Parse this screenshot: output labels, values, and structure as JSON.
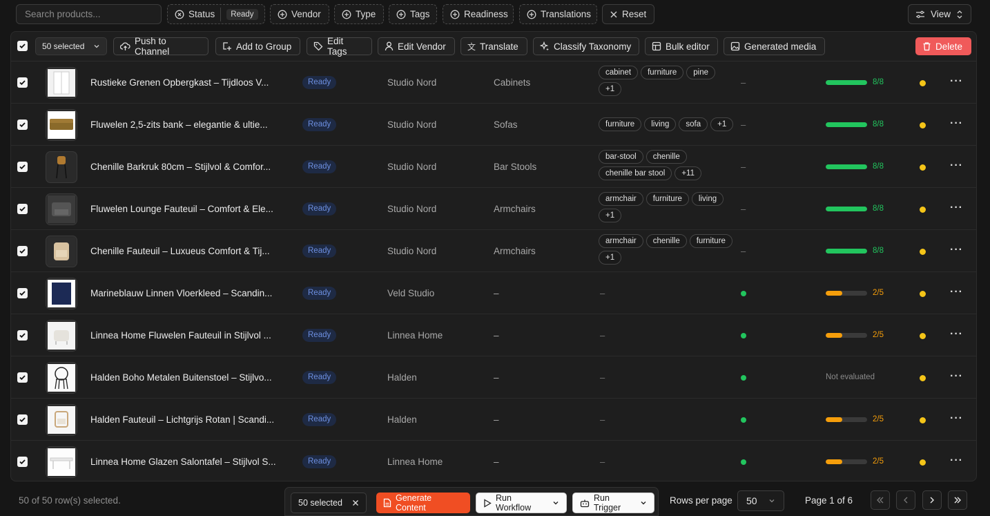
{
  "filters": {
    "search_placeholder": "Search products...",
    "status_label": "Status",
    "status_value": "Ready",
    "vendor_label": "Vendor",
    "type_label": "Type",
    "tags_label": "Tags",
    "readiness_label": "Readiness",
    "translations_label": "Translations",
    "reset_label": "Reset",
    "view_label": "View"
  },
  "toolbar": {
    "selected_label": "50 selected",
    "push_label": "Push to Channel",
    "group_label": "Add to Group",
    "tags_label": "Edit Tags",
    "vendor_label": "Edit Vendor",
    "translate_label": "Translate",
    "classify_label": "Classify Taxonomy",
    "bulk_label": "Bulk editor",
    "media_label": "Generated media",
    "delete_label": "Delete"
  },
  "colors": {
    "accent_green": "#22c55e",
    "accent_orange": "#f59e0b",
    "danger": "#f05a5a",
    "generate": "#f04e23",
    "badge_blue": "#6d8fe0",
    "status_yellow": "#f5c518"
  },
  "rows": [
    {
      "title": "Rustieke Grenen Opbergkast – Tijdloos V...",
      "status": "Ready",
      "vendor": "Studio Nord",
      "type": "Cabinets",
      "tags": [
        "cabinet",
        "furniture",
        "pine",
        "+1"
      ],
      "translations": "–",
      "score": "8/8",
      "score_fraction": 1.0,
      "score_color": "green",
      "thumb": "cabinet-thumb"
    },
    {
      "title": "Fluwelen 2,5-zits bank – elegantie & ultie...",
      "status": "Ready",
      "vendor": "Studio Nord",
      "type": "Sofas",
      "tags": [
        "furniture",
        "living",
        "sofa",
        "+1"
      ],
      "translations": "–",
      "score": "8/8",
      "score_fraction": 1.0,
      "score_color": "green",
      "thumb": "sofa-thumb"
    },
    {
      "title": "Chenille Barkruk 80cm – Stijlvol & Comfor...",
      "status": "Ready",
      "vendor": "Studio Nord",
      "type": "Bar Stools",
      "tags": [
        "bar-stool",
        "chenille",
        "chenille bar stool",
        "+11"
      ],
      "translations": "–",
      "score": "8/8",
      "score_fraction": 1.0,
      "score_color": "green",
      "thumb": "barstool-thumb"
    },
    {
      "title": "Fluwelen Lounge Fauteuil – Comfort & Ele...",
      "status": "Ready",
      "vendor": "Studio Nord",
      "type": "Armchairs",
      "tags": [
        "armchair",
        "furniture",
        "living",
        "+1"
      ],
      "translations": "–",
      "score": "8/8",
      "score_fraction": 1.0,
      "score_color": "green",
      "thumb": "lounge-chair-thumb"
    },
    {
      "title": "Chenille Fauteuil – Luxueus Comfort & Tij...",
      "status": "Ready",
      "vendor": "Studio Nord",
      "type": "Armchairs",
      "tags": [
        "armchair",
        "chenille",
        "furniture",
        "+1"
      ],
      "translations": "–",
      "score": "8/8",
      "score_fraction": 1.0,
      "score_color": "green",
      "thumb": "chenille-chair-thumb"
    },
    {
      "title": "Marineblauw Linnen Vloerkleed – Scandin...",
      "status": "Ready",
      "vendor": "Veld Studio",
      "type": "–",
      "tags": [],
      "tags_empty": "–",
      "translations": "dot",
      "score": "2/5",
      "score_fraction": 0.4,
      "score_color": "orange",
      "thumb": "rug-thumb"
    },
    {
      "title": "Linnea Home Fluwelen Fauteuil in Stijlvol ...",
      "status": "Ready",
      "vendor": "Linnea Home",
      "type": "–",
      "tags": [],
      "tags_empty": "–",
      "translations": "dot",
      "score": "2/5",
      "score_fraction": 0.4,
      "score_color": "orange",
      "thumb": "white-chair-thumb"
    },
    {
      "title": "Halden Boho Metalen Buitenstoel – Stijlvo...",
      "status": "Ready",
      "vendor": "Halden",
      "type": "–",
      "tags": [],
      "tags_empty": "–",
      "translations": "dot",
      "score": "Not evaluated",
      "score_fraction": 0,
      "score_color": "none",
      "thumb": "metal-chair-thumb"
    },
    {
      "title": "Halden Fauteuil – Lichtgrijs Rotan | Scandi...",
      "status": "Ready",
      "vendor": "Halden",
      "type": "–",
      "tags": [],
      "tags_empty": "–",
      "translations": "dot",
      "score": "2/5",
      "score_fraction": 0.4,
      "score_color": "orange",
      "thumb": "rattan-chair-thumb"
    },
    {
      "title": "Linnea Home Glazen Salontafel – Stijlvol S...",
      "status": "Ready",
      "vendor": "Linnea Home",
      "type": "–",
      "tags": [],
      "tags_empty": "–",
      "translations": "dot",
      "score": "2/5",
      "score_fraction": 0.4,
      "score_color": "orange",
      "thumb": "table-thumb"
    }
  ],
  "footer": {
    "selection_text": "50 of 50 row(s) selected.",
    "selected_label": "50 selected",
    "generate_label": "Generate Content",
    "workflow_label": "Run Workflow",
    "trigger_label": "Run Trigger",
    "rows_per_page_label": "Rows per page",
    "rows_per_page_value": "50",
    "page_label": "Page 1 of 6"
  }
}
